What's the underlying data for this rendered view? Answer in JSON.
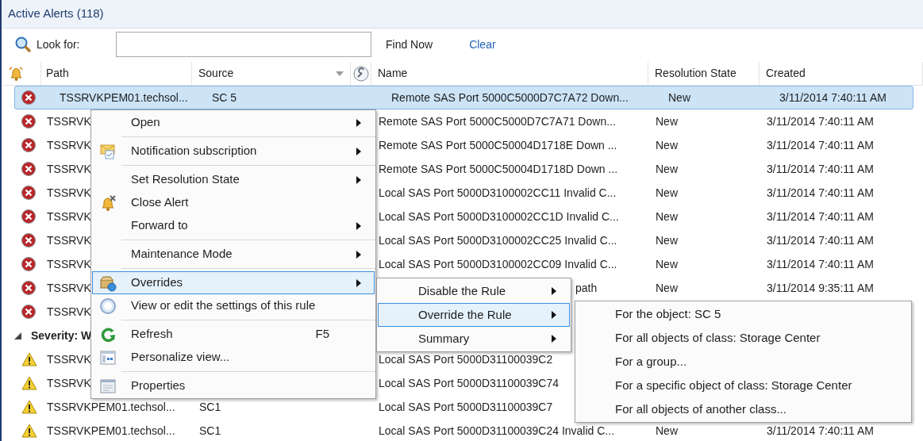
{
  "title": "Active Alerts (118)",
  "search": {
    "label": "Look for:",
    "find_button": "Find Now",
    "clear_link": "Clear"
  },
  "columns": [
    "Path",
    "Source",
    "Name",
    "Resolution State",
    "Created"
  ],
  "rows": [
    {
      "kind": "critical",
      "selected": true,
      "path": "TSSRVKPEM01.techsol...",
      "source": "SC 5",
      "name": "Remote SAS Port 5000C5000D7C7A72 Down...",
      "resolution_state": "New",
      "created": "3/11/2014 7:40:11 AM"
    },
    {
      "kind": "critical",
      "selected": false,
      "path": "TSSRVK",
      "name": "Remote SAS Port 5000C5000D7C7A71 Down...",
      "resolution_state": "New",
      "created": "3/11/2014 7:40:11 AM"
    },
    {
      "kind": "critical",
      "selected": false,
      "path": "TSSRVK",
      "name": "Remote SAS Port 5000C50004D1718E Down ...",
      "resolution_state": "New",
      "created": "3/11/2014 7:40:11 AM"
    },
    {
      "kind": "critical",
      "selected": false,
      "path": "TSSRVK",
      "name": "Remote SAS Port 5000C50004D1718D Down ...",
      "resolution_state": "New",
      "created": "3/11/2014 7:40:11 AM"
    },
    {
      "kind": "critical",
      "selected": false,
      "path": "TSSRVK",
      "name": "Local SAS Port 5000D3100002CC11 Invalid C...",
      "resolution_state": "New",
      "created": "3/11/2014 7:40:11 AM"
    },
    {
      "kind": "critical",
      "selected": false,
      "path": "TSSRVK",
      "name": "Local SAS Port 5000D3100002CC1D Invalid C...",
      "resolution_state": "New",
      "created": "3/11/2014 7:40:11 AM"
    },
    {
      "kind": "critical",
      "selected": false,
      "path": "TSSRVK",
      "name": "Local SAS Port 5000D3100002CC25 Invalid C...",
      "resolution_state": "New",
      "created": "3/11/2014 7:40:11 AM"
    },
    {
      "kind": "critical",
      "selected": false,
      "path": "TSSRVK",
      "name": "Local SAS Port 5000D3100002CC09 Invalid C...",
      "resolution_state": "New",
      "created": "3/11/2014 7:40:11 AM"
    },
    {
      "kind": "critical",
      "selected": false,
      "path": "TSSRVK",
      "name": "path",
      "resolution_state": "New",
      "created": "3/11/2014 9:35:11 AM"
    },
    {
      "kind": "critical",
      "selected": false,
      "path": "TSSRVK"
    },
    {
      "kind": "group",
      "expanded": true,
      "label": "Severity: W"
    },
    {
      "kind": "warning",
      "selected": false,
      "path": "TSSRVK",
      "name": "Local SAS Port 5000D31100039C2"
    },
    {
      "kind": "warning",
      "selected": false,
      "path": "TSSRVK",
      "name": "Local SAS Port 5000D31100039C74"
    },
    {
      "kind": "warning",
      "selected": false,
      "path": "TSSRVKPEM01.techsol...",
      "source": "SC1",
      "name": "Local SAS Port 5000D31100039C7"
    },
    {
      "kind": "warning",
      "selected": false,
      "path": "TSSRVKPEM01.techsol...",
      "source": "SC1",
      "name": "Local SAS Port 5000D31100039C24 Invalid C...",
      "resolution_state": "New",
      "created": "3/11/2014 7:40:11 AM"
    }
  ],
  "context_menu": [
    {
      "kind": "item",
      "label": "Open",
      "submenu": true,
      "selected": false
    },
    {
      "kind": "separator"
    },
    {
      "kind": "item",
      "label": "Notification subscription",
      "submenu": true,
      "selected": false
    },
    {
      "kind": "separator"
    },
    {
      "kind": "item",
      "label": "Set Resolution State",
      "submenu": true,
      "selected": false
    },
    {
      "kind": "item",
      "label": "Close Alert",
      "submenu": false,
      "selected": false
    },
    {
      "kind": "item",
      "label": "Forward to",
      "submenu": true,
      "selected": false
    },
    {
      "kind": "separator"
    },
    {
      "kind": "item",
      "label": "Maintenance Mode",
      "submenu": true,
      "selected": false
    },
    {
      "kind": "separator"
    },
    {
      "kind": "item",
      "label": "Overrides",
      "submenu": true,
      "selected": true
    },
    {
      "kind": "item",
      "label": "View or edit the settings of this rule",
      "submenu": false,
      "selected": false
    },
    {
      "kind": "separator"
    },
    {
      "kind": "item",
      "label": "Refresh",
      "shortcut": "F5",
      "submenu": false,
      "selected": false
    },
    {
      "kind": "item",
      "label": "Personalize view...",
      "submenu": false,
      "selected": false
    },
    {
      "kind": "separator"
    },
    {
      "kind": "item",
      "label": "Properties",
      "submenu": false,
      "selected": false
    }
  ],
  "overrides_menu": [
    {
      "kind": "item",
      "label": "Disable the Rule",
      "submenu": true,
      "selected": false
    },
    {
      "kind": "item",
      "label": "Override the Rule",
      "submenu": true,
      "selected": true
    },
    {
      "kind": "item",
      "label": "Summary",
      "submenu": true,
      "selected": false
    }
  ],
  "override_rule_menu": [
    {
      "kind": "item",
      "label": "For the object: SC 5",
      "submenu": false,
      "selected": false
    },
    {
      "kind": "item",
      "label": "For all objects of class: Storage Center",
      "submenu": false,
      "selected": false
    },
    {
      "kind": "item",
      "label": "For a group...",
      "submenu": false,
      "selected": false
    },
    {
      "kind": "item",
      "label": "For a specific object of class: Storage Center",
      "submenu": false,
      "selected": false
    },
    {
      "kind": "item",
      "label": "For all objects of another class...",
      "submenu": false,
      "selected": false
    }
  ]
}
